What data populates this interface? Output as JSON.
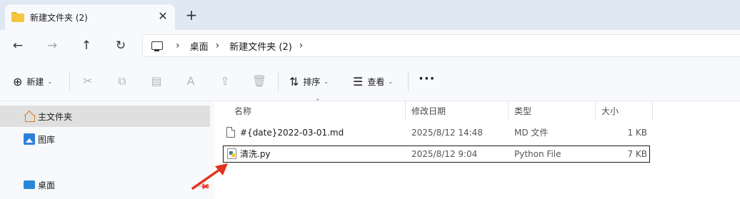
{
  "tabs": [
    {
      "title": "新建文件夹 (2)",
      "close_icon": "✕"
    }
  ],
  "newtab_icon": "+",
  "nav": {
    "back_icon": "←",
    "forward_icon": "→",
    "up_icon": "↑",
    "refresh_icon": "↻"
  },
  "breadcrumb": {
    "separator": "›",
    "items": [
      "桌面",
      "新建文件夹 (2)"
    ]
  },
  "commandbar": {
    "new_label": "新建",
    "new_icon": "⊕",
    "sort_label": "排序",
    "sort_icon": "⇅",
    "view_label": "查看",
    "view_icon": "☰",
    "caret": "⌄",
    "more_icon": "···",
    "cut_icon": "✂",
    "copy_icon": "⧉",
    "paste_icon": "▤",
    "rename_icon": "A",
    "share_icon": "⇪",
    "delete_icon": "🗑"
  },
  "navpane": {
    "items": [
      {
        "label": "主文件夹",
        "icon": "home-icon"
      },
      {
        "label": "图库",
        "icon": "gallery-icon"
      },
      {
        "label": "桌面",
        "icon": "desktop-icon"
      }
    ],
    "pin_icon": "📌"
  },
  "columns": {
    "name": "名称",
    "modified": "修改日期",
    "type": "类型",
    "size": "大小",
    "sort_indicator": "⌃"
  },
  "files": [
    {
      "name": "#{date}2022-03-01.md",
      "modified": "2025/8/12 14:48",
      "type": "MD 文件",
      "size": "1 KB",
      "icon": "file-icon"
    },
    {
      "name": "清洗.py",
      "modified": "2025/8/12 9:04",
      "type": "Python File",
      "size": "7 KB",
      "icon": "python-file-icon",
      "selected": true
    }
  ],
  "colors": {
    "accent_arrow": "#e0341c",
    "tabstrip": "#dfe8f3",
    "selection": "#dfdfdf"
  }
}
